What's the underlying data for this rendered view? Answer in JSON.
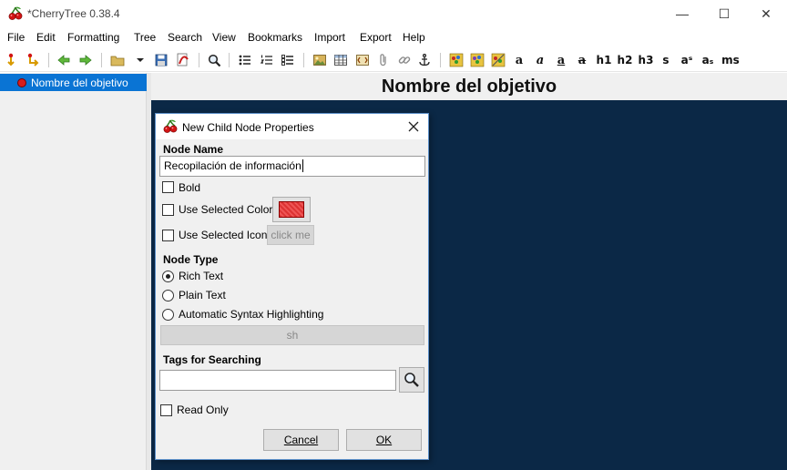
{
  "window": {
    "title": "*CherryTree 0.38.4",
    "controls": {
      "minimize": "—",
      "maximize": "☐",
      "close": "✕"
    }
  },
  "menu": [
    "File",
    "Edit",
    "Formatting",
    "Tree",
    "Search",
    "View",
    "Bookmarks",
    "Import",
    "Export",
    "Help"
  ],
  "toolbar": {
    "format_labels": {
      "bold": "a",
      "italic": "a",
      "underline": "a",
      "strikethrough": "a",
      "h1": "h1",
      "h2": "h2",
      "h3": "h3",
      "small": "s",
      "superscript": "aˢ",
      "subscript": "aₛ",
      "monospace": "ms"
    }
  },
  "tree": {
    "items": [
      {
        "label": "Nombre del objetivo",
        "selected": true
      }
    ]
  },
  "node": {
    "title": "Nombre del objetivo"
  },
  "dialog": {
    "title": "New Child Node Properties",
    "node_name_label": "Node Name",
    "node_name_value": "Recopilación de información",
    "bold_label": "Bold",
    "bold_checked": false,
    "use_color_label": "Use Selected Color",
    "use_color_checked": false,
    "selected_color": "#dd3333",
    "use_icon_label": "Use Selected Icon",
    "use_icon_checked": false,
    "icon_button_label": "click me",
    "node_type_label": "Node Type",
    "node_types": [
      {
        "label": "Rich Text",
        "selected": true
      },
      {
        "label": "Plain Text",
        "selected": false
      },
      {
        "label": "Automatic Syntax Highlighting",
        "selected": false
      }
    ],
    "syntax_value": "sh",
    "tags_label": "Tags for Searching",
    "tags_value": "",
    "read_only_label": "Read Only",
    "read_only_checked": false,
    "cancel_label": "Cancel",
    "ok_label": "OK"
  }
}
